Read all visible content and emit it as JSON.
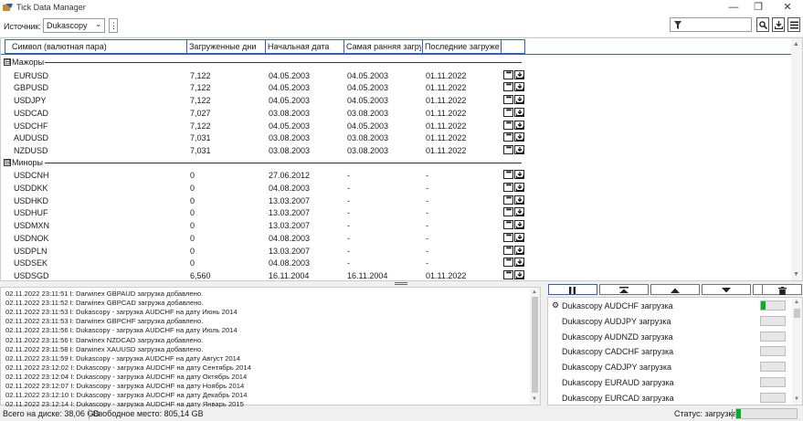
{
  "window": {
    "title": "Tick Data Manager",
    "controls": [
      "—",
      "❐",
      "✕"
    ]
  },
  "toolbar": {
    "source_label": "Источник:",
    "source_value": "Dukascopy",
    "kebab": "⋮"
  },
  "grid": {
    "columns": [
      "Символ (валютная пара)",
      "Загруженные дни",
      "Начальная дата",
      "Самая ранняя загру...",
      "Последние загруже..."
    ],
    "groups": [
      {
        "label": "Мажоры",
        "expanded": "⊟",
        "rows": [
          {
            "symbol": "EURUSD",
            "days": "7,122",
            "start": "04.05.2003",
            "earliest": "04.05.2003",
            "latest": "01.11.2022"
          },
          {
            "symbol": "GBPUSD",
            "days": "7,122",
            "start": "04.05.2003",
            "earliest": "04.05.2003",
            "latest": "01.11.2022"
          },
          {
            "symbol": "USDJPY",
            "days": "7,122",
            "start": "04.05.2003",
            "earliest": "04.05.2003",
            "latest": "01.11.2022"
          },
          {
            "symbol": "USDCAD",
            "days": "7,027",
            "start": "03.08.2003",
            "earliest": "03.08.2003",
            "latest": "01.11.2022"
          },
          {
            "symbol": "USDCHF",
            "days": "7,122",
            "start": "04.05.2003",
            "earliest": "04.05.2003",
            "latest": "01.11.2022"
          },
          {
            "symbol": "AUDUSD",
            "days": "7,031",
            "start": "03.08.2003",
            "earliest": "03.08.2003",
            "latest": "01.11.2022"
          },
          {
            "symbol": "NZDUSD",
            "days": "7,031",
            "start": "03.08.2003",
            "earliest": "03.08.2003",
            "latest": "01.11.2022"
          }
        ]
      },
      {
        "label": "Миноры",
        "expanded": "⊟",
        "rows": [
          {
            "symbol": "USDCNH",
            "days": "0",
            "start": "27.06.2012",
            "earliest": "-",
            "latest": "-"
          },
          {
            "symbol": "USDDKK",
            "days": "0",
            "start": "04.08.2003",
            "earliest": "-",
            "latest": "-"
          },
          {
            "symbol": "USDHKD",
            "days": "0",
            "start": "13.03.2007",
            "earliest": "-",
            "latest": "-"
          },
          {
            "symbol": "USDHUF",
            "days": "0",
            "start": "13.03.2007",
            "earliest": "-",
            "latest": "-"
          },
          {
            "symbol": "USDMXN",
            "days": "0",
            "start": "13.03.2007",
            "earliest": "-",
            "latest": "-"
          },
          {
            "symbol": "USDNOK",
            "days": "0",
            "start": "04.08.2003",
            "earliest": "-",
            "latest": "-"
          },
          {
            "symbol": "USDPLN",
            "days": "0",
            "start": "13.03.2007",
            "earliest": "-",
            "latest": "-"
          },
          {
            "symbol": "USDSEK",
            "days": "0",
            "start": "04.08.2003",
            "earliest": "-",
            "latest": "-"
          },
          {
            "symbol": "USDSGD",
            "days": "6,560",
            "start": "16.11.2004",
            "earliest": "16.11.2004",
            "latest": "01.11.2022"
          }
        ]
      }
    ]
  },
  "log": [
    "02.11.2022 23:11:51  I: Darwinex GBPAUD загрузка добавлено.",
    "02.11.2022 23:11:52  I: Darwinex GBPCAD загрузка добавлено.",
    "02.11.2022 23:11:53  I: Dukascopy - загрузка AUDCHF на дату Июнь 2014",
    "02.11.2022 23:11:53  I: Darwinex GBPCHF загрузка добавлено.",
    "02.11.2022 23:11:56  I: Dukascopy - загрузка AUDCHF на дату Июль 2014",
    "02.11.2022 23:11:56  I: Darwinex NZDCAD загрузка добавлено.",
    "02.11.2022 23:11:58  I: Darwinex XAUUSD загрузка добавлено.",
    "02.11.2022 23:11:59  I: Dukascopy - загрузка AUDCHF на дату Август 2014",
    "02.11.2022 23:12:02  I: Dukascopy - загрузка AUDCHF на дату Сентябрь 2014",
    "02.11.2022 23:12:04  I: Dukascopy - загрузка AUDCHF на дату Октябрь 2014",
    "02.11.2022 23:12:07  I: Dukascopy - загрузка AUDCHF на дату Ноябрь 2014",
    "02.11.2022 23:12:10  I: Dukascopy - загрузка AUDCHF на дату Декабрь 2014",
    "02.11.2022 23:12:14  I: Dukascopy - загрузка AUDCHF на дату Январь 2015"
  ],
  "queue": [
    {
      "text": "Dukascopy AUDCHF загрузка",
      "active": true,
      "progress": 0.2
    },
    {
      "text": "Dukascopy AUDJPY загрузка",
      "active": false,
      "progress": 0
    },
    {
      "text": "Dukascopy AUDNZD загрузка",
      "active": false,
      "progress": 0
    },
    {
      "text": "Dukascopy CADCHF загрузка",
      "active": false,
      "progress": 0
    },
    {
      "text": "Dukascopy CADJPY загрузка",
      "active": false,
      "progress": 0
    },
    {
      "text": "Dukascopy EURAUD загрузка",
      "active": false,
      "progress": 0
    },
    {
      "text": "Dukascopy EURCAD загрузка",
      "active": false,
      "progress": 0
    }
  ],
  "status": {
    "disk_total": "Всего на диске: 38,06 GB",
    "free_space": "Свободное место: 805,14 GB",
    "state": "Статус: загрузка",
    "progress": 0.08
  },
  "colors": {
    "accent": "#3060c0",
    "progress": "#06b025"
  },
  "icons": {
    "app": "app-icon",
    "filter": "filter-icon",
    "search": "search-icon",
    "download": "download-icon",
    "menu": "hamburger-icon",
    "pause": "pause-icon",
    "top": "move-top-icon",
    "up": "move-up-icon",
    "down": "move-down-icon",
    "bottom": "move-bottom-icon",
    "delete": "trash-icon",
    "gear": "gear-icon"
  }
}
